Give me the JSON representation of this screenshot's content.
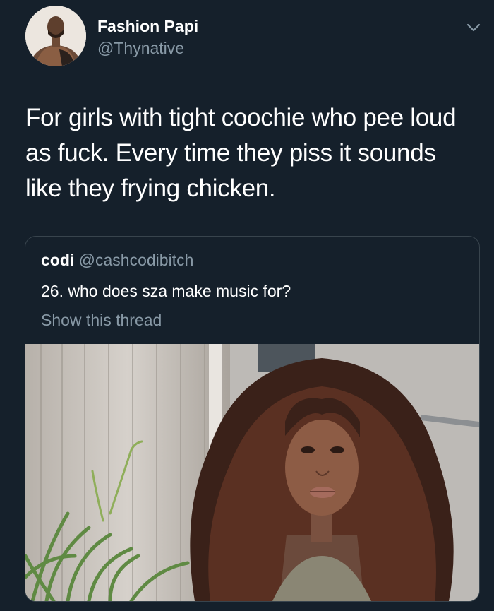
{
  "tweet": {
    "author_name": "Fashion Papi",
    "author_handle": "@Thynative",
    "text": "For girls with tight coochie who pee loud as fuck. Every time they piss it sounds like they frying chicken."
  },
  "quoted_tweet": {
    "author_name": "codi",
    "author_handle": "@cashcodibitch",
    "text": "26. who does sza make music for?",
    "show_thread_label": "Show this thread"
  },
  "colors": {
    "background": "#15202b",
    "secondary_text": "#8899a6",
    "border": "#38444d"
  },
  "icons": {
    "menu": "chevron-down-icon"
  }
}
